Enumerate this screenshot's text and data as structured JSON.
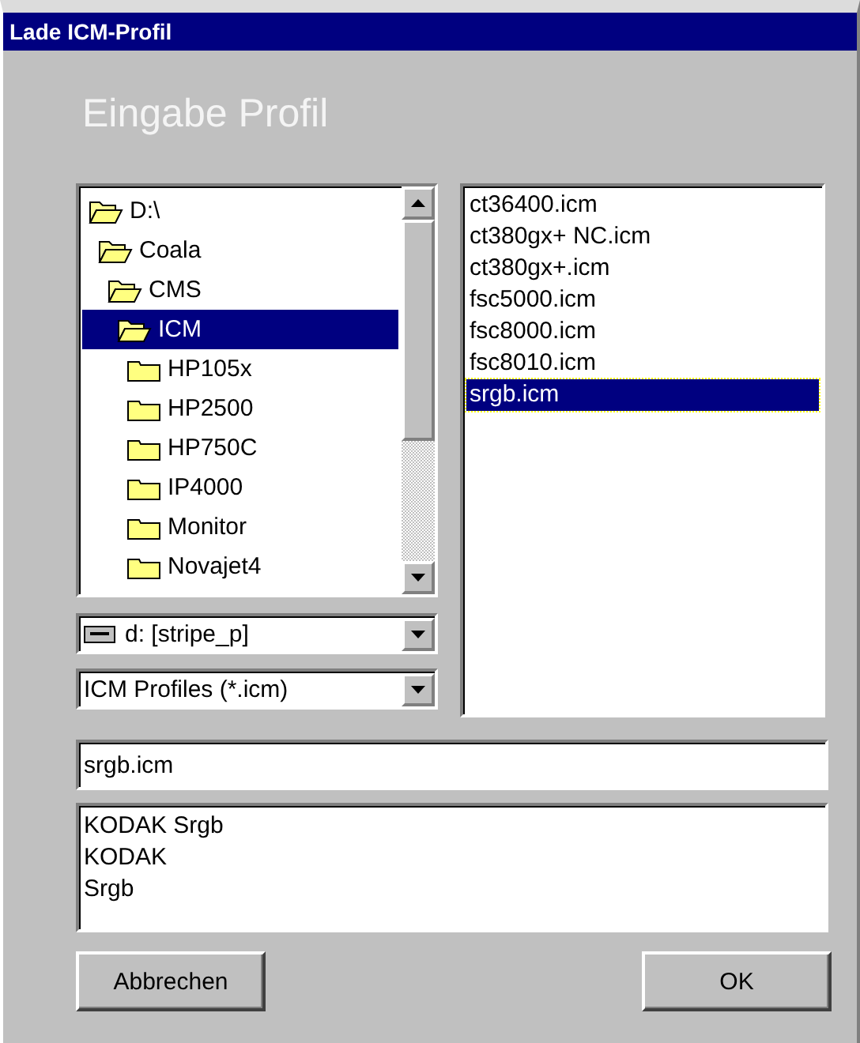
{
  "window": {
    "title": "Lade ICM-Profil"
  },
  "heading": "Eingabe Profil",
  "folder_tree": [
    {
      "label": "D:\\",
      "expanded": true,
      "selected": false,
      "children": [
        {
          "label": "Coala",
          "expanded": true,
          "selected": false,
          "children": [
            {
              "label": "CMS",
              "expanded": true,
              "selected": false,
              "children": [
                {
                  "label": "ICM",
                  "expanded": true,
                  "selected": true,
                  "children": [
                    {
                      "label": "HP105x",
                      "expanded": false,
                      "selected": false
                    },
                    {
                      "label": "HP2500",
                      "expanded": false,
                      "selected": false
                    },
                    {
                      "label": "HP750C",
                      "expanded": false,
                      "selected": false
                    },
                    {
                      "label": "IP4000",
                      "expanded": false,
                      "selected": false
                    },
                    {
                      "label": "Monitor",
                      "expanded": false,
                      "selected": false
                    },
                    {
                      "label": "Novajet4",
                      "expanded": false,
                      "selected": false
                    }
                  ]
                }
              ]
            }
          ]
        }
      ]
    }
  ],
  "drive_select": {
    "value": "d: [stripe_p]"
  },
  "filter_select": {
    "value": "ICM Profiles (*.icm)"
  },
  "files": [
    {
      "label": "ct36400.icm",
      "selected": false
    },
    {
      "label": "ct380gx+ NC.icm",
      "selected": false
    },
    {
      "label": "ct380gx+.icm",
      "selected": false
    },
    {
      "label": "fsc5000.icm",
      "selected": false
    },
    {
      "label": "fsc8000.icm",
      "selected": false
    },
    {
      "label": "fsc8010.icm",
      "selected": false
    },
    {
      "label": "srgb.icm",
      "selected": true
    }
  ],
  "filename_field": {
    "value": "srgb.icm"
  },
  "description": [
    "KODAK Srgb",
    "KODAK",
    "Srgb"
  ],
  "buttons": [
    "Abbrechen",
    "OK"
  ]
}
